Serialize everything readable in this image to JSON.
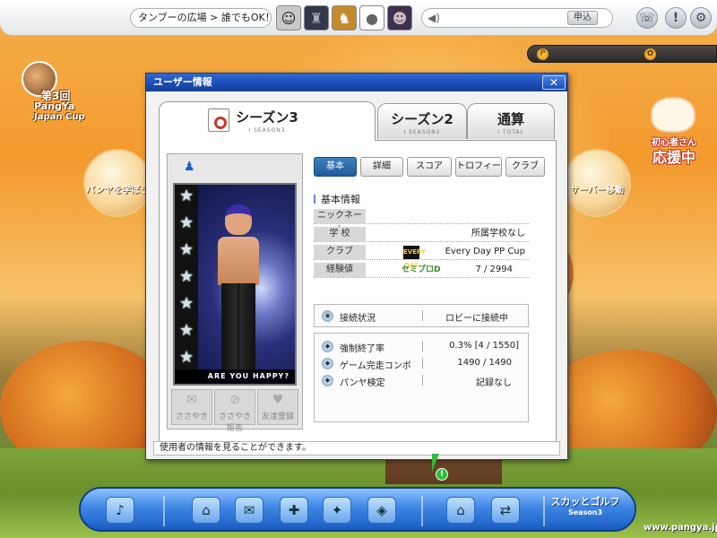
{
  "topbar": {
    "location": "タンブーの広場 > 誰でもOK！1",
    "avatar_icons": [
      "character-a-icon",
      "character-b-icon",
      "character-c-icon",
      "pangya-ball-icon",
      "character-d-icon"
    ],
    "apply_label": "申込",
    "right_icons": [
      "option-icon",
      "help-icon",
      "settings-icon"
    ]
  },
  "side": {
    "cup_line1": "第3回",
    "cup_line2": "PangYa",
    "cup_line3": "Japan Cup",
    "left_circle_label": "パンヤを学ぼう",
    "right_circle_label": "サーバー移動",
    "beginner_line1": "初心者さん",
    "beginner_line2": "応援中"
  },
  "dialog": {
    "title": "ユーザー情報",
    "close_label": "✕",
    "season_tabs": [
      {
        "label": "シーズン3",
        "sub": "I SEASON3"
      },
      {
        "label": "シーズン2",
        "sub": "I SEASON2"
      },
      {
        "label": "通算",
        "sub": "I TOTAL"
      }
    ],
    "category_tabs": [
      "基本",
      "詳細",
      "スコア",
      "トロフィー",
      "クラブ"
    ],
    "card": {
      "banner": "ARE YOU HAPPY?",
      "actions": [
        "ささやき",
        "ささやき拒否",
        "友達登録"
      ]
    },
    "section_title": "基本情報",
    "info": {
      "nickname_label": "ニックネーム",
      "nickname_value": "",
      "school_label": "学 校",
      "school_value": "所属学校なし",
      "club_label": "クラブ",
      "club_logo": "EVERY DAY",
      "club_value": "Every Day PP Cup",
      "exp_label": "経験値",
      "rank": "セミプロD",
      "exp_value": "7 / 2994"
    },
    "status": {
      "label": "接続状況",
      "value": "ロビーに接続中"
    },
    "stats": [
      {
        "label": "強制終了率",
        "value": "0.3% [4 / 1550]"
      },
      {
        "label": "ゲーム完走コンボ",
        "value": "1490 / 1490"
      },
      {
        "label": "パンヤ検定",
        "value": "記録なし"
      }
    ],
    "footer": "使用者の情報を見ることができます。"
  },
  "bottombar": {
    "logo_main": "スカッとゴルフ",
    "logo_sub": "Season3",
    "url": "www.pangya.jp"
  },
  "colors": {
    "titlebar": "#1d4fb8",
    "active_tab": "#2f6fae",
    "toolbar": "#3f86e4"
  }
}
